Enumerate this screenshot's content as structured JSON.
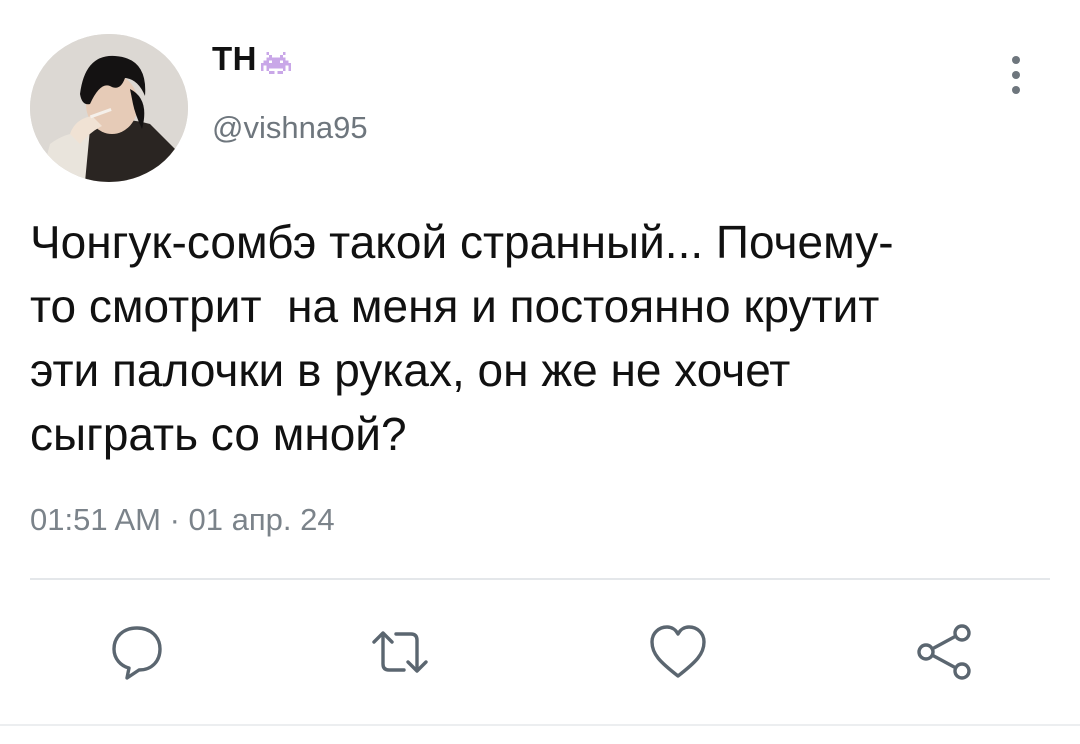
{
  "author": {
    "display_name": "ТН",
    "handle": "@vishna95",
    "name_emoji": "space-invader-icon",
    "avatar_icon": "profile-photo"
  },
  "tweet": {
    "text": "Чонгук-сомбэ такой странный... Почему-\nто смотрит  на меня и постоянно крутит\nэти палочки в руках, он же не хочет\nсыграть со мной?",
    "timestamp": "01:51 AM · 01 апр. 24"
  },
  "actions": {
    "reply_icon": "reply-icon",
    "retweet_icon": "retweet-icon",
    "like_icon": "heart-icon",
    "share_icon": "share-icon"
  },
  "colors": {
    "text": "#111111",
    "secondary": "#6e767d",
    "divider": "#e4e7ea",
    "emoji": "#c9a7e8"
  }
}
